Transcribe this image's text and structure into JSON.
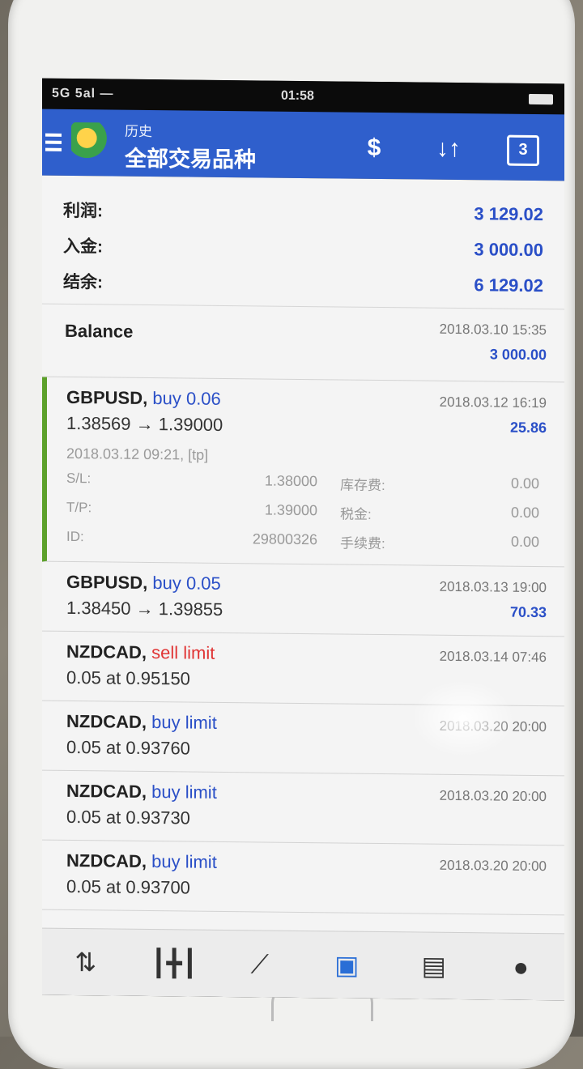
{
  "statusbar": {
    "left": "5G 5al —",
    "time": "01:58"
  },
  "appbar": {
    "subtitle": "历史",
    "title": "全部交易品种",
    "icons": [
      "currency-dollar-icon",
      "sort-arrows-icon",
      "calendar-icon"
    ],
    "calendar_day": "3"
  },
  "summary": [
    {
      "label": "利润:",
      "value": "3 129.02"
    },
    {
      "label": "入金:",
      "value": "3 000.00"
    },
    {
      "label": "结余:",
      "value": "6 129.02"
    }
  ],
  "balance_row": {
    "title": "Balance",
    "date": "2018.03.10 15:35",
    "amount": "3 000.00"
  },
  "expanded_trade": {
    "symbol": "GBPUSD,",
    "direction": "buy 0.06",
    "prices": "1.38569 → 1.39000",
    "date": "2018.03.12 16:19",
    "profit": "25.86",
    "open_time": "2018.03.12 09:21, [tp]",
    "sl_label": "S/L:",
    "sl_value": "1.38000",
    "tp_label": "T/P:",
    "tp_value": "1.39000",
    "id_label": "ID:",
    "id_value": "29800326",
    "swap_label": "库存费:",
    "swap_value": "0.00",
    "tax_label": "税金:",
    "tax_value": "0.00",
    "commission_label": "手续费:",
    "commission_value": "0.00"
  },
  "trades": [
    {
      "symbol": "GBPUSD,",
      "direction": "buy 0.05",
      "dir_type": "buy",
      "sub": "1.38450 → 1.39855",
      "date": "2018.03.13 19:00",
      "amount": "70.33"
    },
    {
      "symbol": "NZDCAD,",
      "direction": "sell limit",
      "dir_type": "sell",
      "sub": "0.05 at 0.95150",
      "date": "2018.03.14 07:46",
      "amount": ""
    },
    {
      "symbol": "NZDCAD,",
      "direction": "buy limit",
      "dir_type": "buy",
      "sub": "0.05 at 0.93760",
      "date": "2018.03.20 20:00",
      "amount": ""
    },
    {
      "symbol": "NZDCAD,",
      "direction": "buy limit",
      "dir_type": "buy",
      "sub": "0.05 at 0.93730",
      "date": "2018.03.20 20:00",
      "amount": ""
    },
    {
      "symbol": "NZDCAD,",
      "direction": "buy limit",
      "dir_type": "buy",
      "sub": "0.05 at 0.93700",
      "date": "2018.03.20 20:00",
      "amount": ""
    }
  ],
  "bottom_nav": {
    "items": [
      "quotes-icon",
      "chart-candles-icon",
      "trade-icon",
      "history-inbox-icon",
      "news-icon",
      "chat-icon"
    ],
    "active": "history-inbox-icon"
  },
  "colors": {
    "appbar": "#2f5fcc",
    "buy": "#2a4fc7",
    "sell": "#e03434",
    "expanded_marker": "#5ca02a"
  }
}
